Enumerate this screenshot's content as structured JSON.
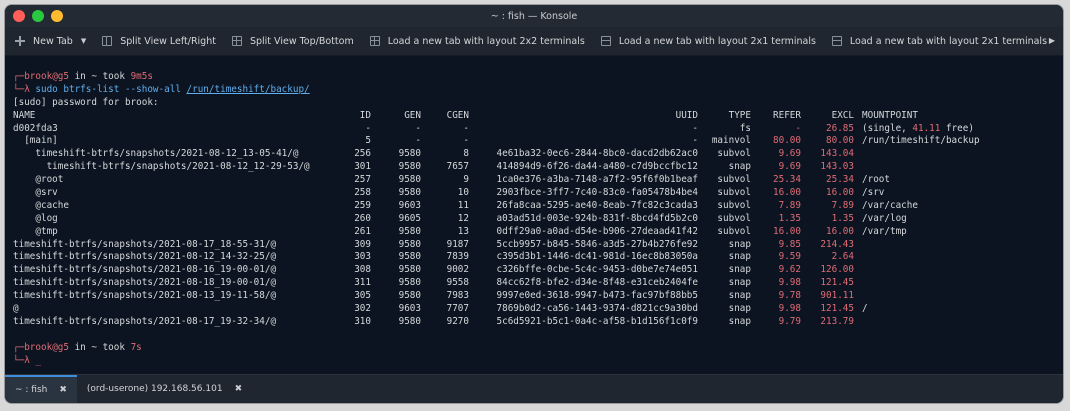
{
  "window": {
    "title": "~ : fish — Konsole"
  },
  "toolbar": {
    "new_tab": "New Tab",
    "split_lr": "Split View Left/Right",
    "split_tb": "Split View Top/Bottom",
    "layout_2x2": "Load a new tab with layout 2x2 terminals",
    "layout_2x1_a": "Load a new tab with layout 2x1 terminals",
    "layout_2x1_b": "Load a new tab with layout 2x1 terminals"
  },
  "terminal": {
    "prompt1": {
      "bracket": "┌─",
      "user": "brook@g5",
      "in": " in ~ took ",
      "took": "9m5s"
    },
    "cmd1": {
      "lambda": "└─λ ",
      "cmd": "sudo btrfs-list --show-all ",
      "path": "/run/timeshift/backup/"
    },
    "sudo_line": "[sudo] password for brook:",
    "header": {
      "name": "NAME",
      "id": "ID",
      "gen": "GEN",
      "cgen": "CGEN",
      "uuid": "UUID",
      "type": "TYPE",
      "refer": "REFER",
      "excl": "EXCL",
      "mount": "MOUNTPOINT"
    },
    "rows": [
      {
        "name": "d002fda3",
        "id": "-",
        "gen": "-",
        "cgen": "-",
        "uuid": "-",
        "type": "fs",
        "refer": "-",
        "excl": "26.85",
        "mount": "(single, ",
        "mount_red": "41.11",
        "mount_tail": " free)"
      },
      {
        "name": "  [main]",
        "id": "5",
        "gen": "-",
        "cgen": "-",
        "uuid": "-",
        "type": "mainvol",
        "refer": "80.00",
        "excl": "80.00",
        "mount": "/run/timeshift/backup"
      },
      {
        "name": "    timeshift-btrfs/snapshots/2021-08-12_13-05-41/@",
        "id": "256",
        "gen": "9580",
        "cgen": "8",
        "uuid": "4e61ba32-0ec6-2844-8bc0-dacd2db62ac0",
        "type": "subvol",
        "refer": "9.69",
        "excl": "143.04",
        "mount": ""
      },
      {
        "name": "      timeshift-btrfs/snapshots/2021-08-12_12-29-53/@",
        "id": "301",
        "gen": "9580",
        "cgen": "7657",
        "uuid": "414894d9-6f26-da44-a480-c7d9bccfbc12",
        "type": "snap",
        "refer": "9.69",
        "excl": "143.03",
        "mount": ""
      },
      {
        "name": "    @root",
        "id": "257",
        "gen": "9580",
        "cgen": "9",
        "uuid": "1ca0e376-a3ba-7148-a7f2-95f6f0b1beaf",
        "type": "subvol",
        "refer": "25.34",
        "excl": "25.34",
        "mount": "/root"
      },
      {
        "name": "    @srv",
        "id": "258",
        "gen": "9580",
        "cgen": "10",
        "uuid": "2903fbce-3ff7-7c40-83c0-fa05478b4be4",
        "type": "subvol",
        "refer": "16.00",
        "excl": "16.00",
        "mount": "/srv"
      },
      {
        "name": "    @cache",
        "id": "259",
        "gen": "9603",
        "cgen": "11",
        "uuid": "26fa8caa-5295-ae40-8eab-7fc82c3cada3",
        "type": "subvol",
        "refer": "7.89",
        "excl": "7.89",
        "mount": "/var/cache"
      },
      {
        "name": "    @log",
        "id": "260",
        "gen": "9605",
        "cgen": "12",
        "uuid": "a03ad51d-003e-924b-831f-8bcd4fd5b2c0",
        "type": "subvol",
        "refer": "1.35",
        "excl": "1.35",
        "mount": "/var/log"
      },
      {
        "name": "    @tmp",
        "id": "261",
        "gen": "9580",
        "cgen": "13",
        "uuid": "0dff29a0-a0ad-d54e-b906-27deaad41f42",
        "type": "subvol",
        "refer": "16.00",
        "excl": "16.00",
        "mount": "/var/tmp"
      },
      {
        "name": "timeshift-btrfs/snapshots/2021-08-17_18-55-31/@",
        "id": "309",
        "gen": "9580",
        "cgen": "9187",
        "uuid": "5ccb9957-b845-5846-a3d5-27b4b276fe92",
        "type": "snap",
        "refer": "9.85",
        "excl": "214.43",
        "mount": ""
      },
      {
        "name": "timeshift-btrfs/snapshots/2021-08-12_14-32-25/@",
        "id": "303",
        "gen": "9580",
        "cgen": "7839",
        "uuid": "c395d3b1-1446-dc41-981d-16ec8b83050a",
        "type": "snap",
        "refer": "9.59",
        "excl": "2.64",
        "mount": ""
      },
      {
        "name": "timeshift-btrfs/snapshots/2021-08-16_19-00-01/@",
        "id": "308",
        "gen": "9580",
        "cgen": "9002",
        "uuid": "c326bffe-0cbe-5c4c-9453-d0be7e74e051",
        "type": "snap",
        "refer": "9.62",
        "excl": "126.00",
        "mount": ""
      },
      {
        "name": "timeshift-btrfs/snapshots/2021-08-18_19-00-01/@",
        "id": "311",
        "gen": "9580",
        "cgen": "9558",
        "uuid": "84cc62f8-bfe2-d34e-8f48-e31ceb2404fe",
        "type": "snap",
        "refer": "9.98",
        "excl": "121.45",
        "mount": ""
      },
      {
        "name": "timeshift-btrfs/snapshots/2021-08-13_19-11-58/@",
        "id": "305",
        "gen": "9580",
        "cgen": "7983",
        "uuid": "9997e0ed-3618-9947-b473-fac97bf88bb5",
        "type": "snap",
        "refer": "9.78",
        "excl": "901.11",
        "mount": ""
      },
      {
        "name": "@",
        "id": "302",
        "gen": "9603",
        "cgen": "7707",
        "uuid": "7869b0d2-ca56-1443-9374-d821cc9a30bd",
        "type": "snap",
        "refer": "9.98",
        "excl": "121.45",
        "mount": "/"
      },
      {
        "name": "timeshift-btrfs/snapshots/2021-08-17_19-32-34/@",
        "id": "310",
        "gen": "9580",
        "cgen": "9270",
        "uuid": "5c6d5921-b5c1-0a4c-af58-b1d156f1c0f9",
        "type": "snap",
        "refer": "9.79",
        "excl": "213.79",
        "mount": ""
      }
    ],
    "prompt2": {
      "bracket": "┌─",
      "user": "brook@g5",
      "in": " in ~ took ",
      "took": "7s"
    },
    "cmd2": {
      "lambda": "└─λ ",
      "cursor": "_"
    }
  },
  "tabs": [
    {
      "label": "~ : fish",
      "close": "✖"
    },
    {
      "label": "(ord-userone) 192.168.56.101",
      "close": "✖"
    }
  ],
  "colors": {
    "accent": "#3d8fd9",
    "prompt_red": "#e06c75",
    "cmd_blue": "#61aeee",
    "bg": "#0b1420"
  }
}
